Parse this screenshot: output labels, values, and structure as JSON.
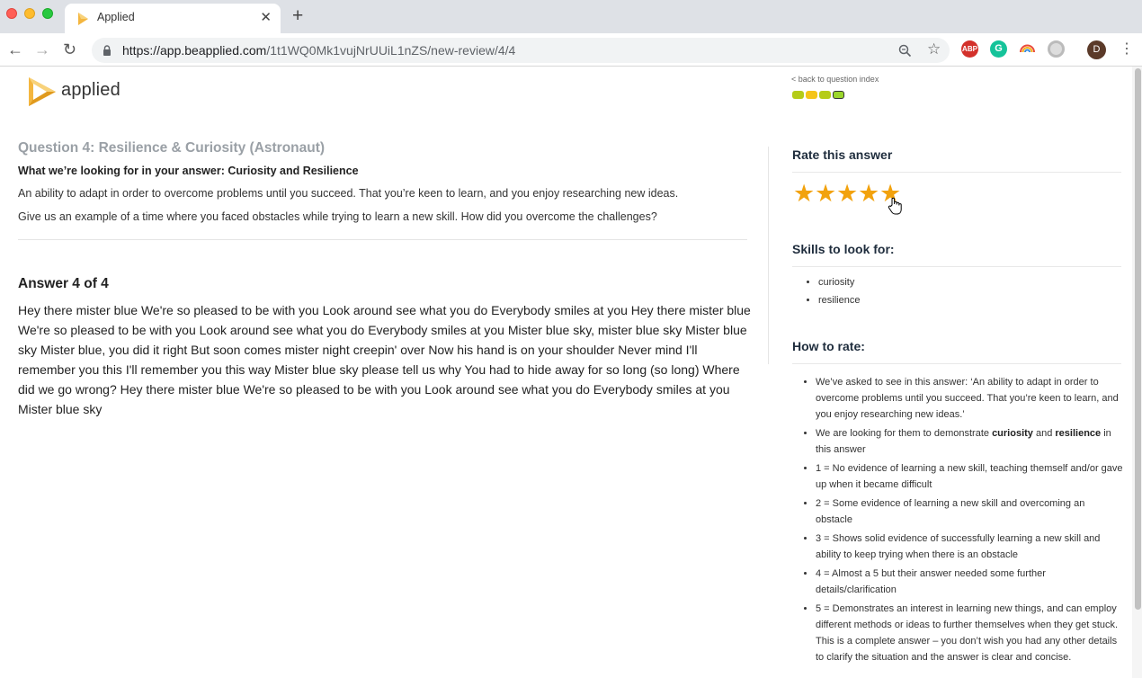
{
  "browser": {
    "tab_title": "Applied",
    "tab_close": "✕",
    "new_tab": "+",
    "url_host": "https://app.beapplied.com",
    "url_path": "/1t1WQ0Mk1vujNrUUiL1nZS/new-review/4/4",
    "ext_abp": "ABP",
    "ext_g": "G",
    "profile_initial": "D"
  },
  "header": {
    "logo_text": "applied",
    "back_link": "< back to question index",
    "progress_colors": [
      "#b5cc18",
      "#f5c518",
      "#b5cc18",
      "#9bd62b"
    ]
  },
  "question": {
    "title": "Question 4: Resilience & Curiosity (Astronaut)",
    "looking_for": "What we’re looking for in your answer: Curiosity and Resilience",
    "description": "An ability to adapt in order to overcome problems until you succeed. That you’re keen to learn, and you enjoy researching new ideas.",
    "prompt": "Give us an example of a time where you faced obstacles while trying to learn a new skill. How did you overcome the challenges?"
  },
  "answer": {
    "heading": "Answer 4 of 4",
    "text": "Hey there mister blue We're so pleased to be with you Look around see what you do Everybody smiles at you Hey there mister blue We're so pleased to be with you Look around see what you do Everybody smiles at you Mister blue sky, mister blue sky Mister blue sky Mister blue, you did it right But soon comes mister night creepin' over Now his hand is on your shoulder Never mind I'll remember you this I'll remember you this way Mister blue sky please tell us why You had to hide away for so long (so long) Where did we go wrong? Hey there mister blue We're so pleased to be with you Look around see what you do Everybody smiles at you Mister blue sky"
  },
  "rating": {
    "heading": "Rate this answer",
    "rating": 5,
    "max": 5,
    "star_glyph": "★"
  },
  "skills": {
    "heading": "Skills to look for:",
    "items": [
      "curiosity",
      "resilience"
    ]
  },
  "how_to_rate": {
    "heading": "How to rate:",
    "item1": "We’ve asked to see in this answer: ‘An ability to adapt in order to overcome problems until you succeed. That you’re keen to learn, and you enjoy researching new ideas.’",
    "item2_pre": "We are looking for them to demonstrate ",
    "item2_b1": "curiosity",
    "item2_mid": " and ",
    "item2_b2": "resilience",
    "item2_post": " in this answer",
    "item3": "1 = No evidence of learning a new skill, teaching themself and/or gave up when it became difficult",
    "item4": "2 = Some evidence of learning a new skill and overcoming an obstacle",
    "item5": "3 = Shows solid evidence of successfully learning a new skill and ability to keep trying when there is an obstacle",
    "item6": "4 = Almost a 5 but their answer needed some further details/clarification",
    "item7": "5 = Demonstrates an interest in learning new things, and can employ different methods or ideas to further themselves when they get stuck. This is a complete answer – you don’t wish you had any other details to clarify the situation and the answer is clear and concise."
  }
}
